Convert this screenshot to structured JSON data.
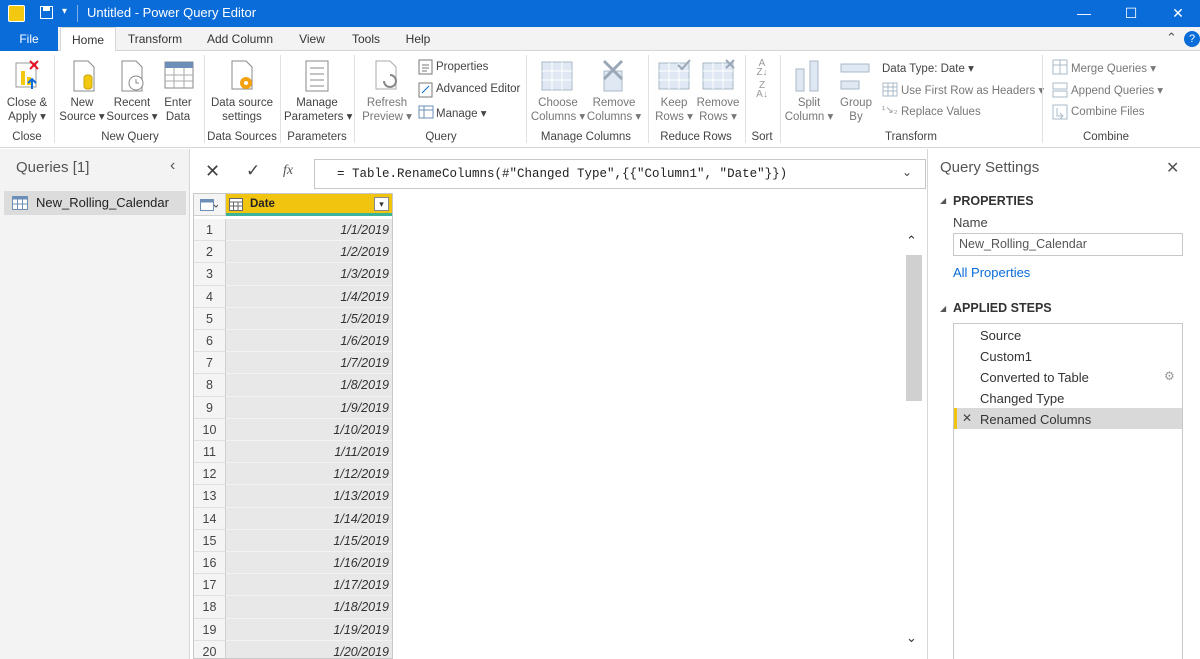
{
  "window": {
    "title": "Untitled - Power Query Editor",
    "controls": {
      "minimize": "—",
      "maximize": "☐",
      "close": "✕"
    }
  },
  "tabs": [
    "File",
    "Home",
    "Transform",
    "Add Column",
    "View",
    "Tools",
    "Help"
  ],
  "ribbon": {
    "close_apply": {
      "line1": "Close &",
      "line2": "Apply ▾"
    },
    "new_source": {
      "line1": "New",
      "line2": "Source ▾"
    },
    "recent_sources": {
      "line1": "Recent",
      "line2": "Sources ▾"
    },
    "enter_data": {
      "line1": "Enter",
      "line2": "Data"
    },
    "data_source_settings": {
      "line1": "Data source",
      "line2": "settings"
    },
    "manage_parameters": {
      "line1": "Manage",
      "line2": "Parameters ▾"
    },
    "refresh_preview": {
      "line1": "Refresh",
      "line2": "Preview ▾"
    },
    "properties": "Properties",
    "advanced_editor": "Advanced Editor",
    "manage": "Manage ▾",
    "choose_columns": {
      "line1": "Choose",
      "line2": "Columns ▾"
    },
    "remove_columns": {
      "line1": "Remove",
      "line2": "Columns ▾"
    },
    "keep_rows": {
      "line1": "Keep",
      "line2": "Rows ▾"
    },
    "remove_rows": {
      "line1": "Remove",
      "line2": "Rows ▾"
    },
    "split_column": {
      "line1": "Split",
      "line2": "Column ▾"
    },
    "group_by": {
      "line1": "Group",
      "line2": "By"
    },
    "data_type": "Data Type: Date ▾",
    "use_first_row": "Use First Row as Headers ▾",
    "replace_values": "Replace Values",
    "merge_queries": "Merge Queries ▾",
    "append_queries": "Append Queries ▾",
    "combine_files": "Combine Files",
    "groups": {
      "close": "Close",
      "new_query": "New Query",
      "data_sources": "Data Sources",
      "parameters": "Parameters",
      "query": "Query",
      "manage_columns": "Manage Columns",
      "reduce_rows": "Reduce Rows",
      "sort": "Sort",
      "transform": "Transform",
      "combine": "Combine"
    }
  },
  "queries": {
    "header": "Queries [1]",
    "items": [
      "New_Rolling_Calendar"
    ]
  },
  "formula_bar": {
    "fx": "fx",
    "formula": "= Table.RenameColumns(#\"Changed Type\",{{\"Column1\", \"Date\"}})"
  },
  "grid": {
    "column_header": "Date",
    "rows": [
      {
        "n": "1",
        "v": "1/1/2019"
      },
      {
        "n": "2",
        "v": "1/2/2019"
      },
      {
        "n": "3",
        "v": "1/3/2019"
      },
      {
        "n": "4",
        "v": "1/4/2019"
      },
      {
        "n": "5",
        "v": "1/5/2019"
      },
      {
        "n": "6",
        "v": "1/6/2019"
      },
      {
        "n": "7",
        "v": "1/7/2019"
      },
      {
        "n": "8",
        "v": "1/8/2019"
      },
      {
        "n": "9",
        "v": "1/9/2019"
      },
      {
        "n": "10",
        "v": "1/10/2019"
      },
      {
        "n": "11",
        "v": "1/11/2019"
      },
      {
        "n": "12",
        "v": "1/12/2019"
      },
      {
        "n": "13",
        "v": "1/13/2019"
      },
      {
        "n": "14",
        "v": "1/14/2019"
      },
      {
        "n": "15",
        "v": "1/15/2019"
      },
      {
        "n": "16",
        "v": "1/16/2019"
      },
      {
        "n": "17",
        "v": "1/17/2019"
      },
      {
        "n": "18",
        "v": "1/18/2019"
      },
      {
        "n": "19",
        "v": "1/19/2019"
      },
      {
        "n": "20",
        "v": "1/20/2019"
      }
    ]
  },
  "query_settings": {
    "title": "Query Settings",
    "properties_header": "PROPERTIES",
    "name_label": "Name",
    "name_value": "New_Rolling_Calendar",
    "all_properties": "All Properties",
    "applied_steps_header": "APPLIED STEPS",
    "steps": [
      "Source",
      "Custom1",
      "Converted to Table",
      "Changed Type",
      "Renamed Columns"
    ]
  },
  "colors": {
    "accent": "#0a6cd8",
    "column_header": "#f1c40f",
    "quality_bar": "#3bb39a"
  }
}
